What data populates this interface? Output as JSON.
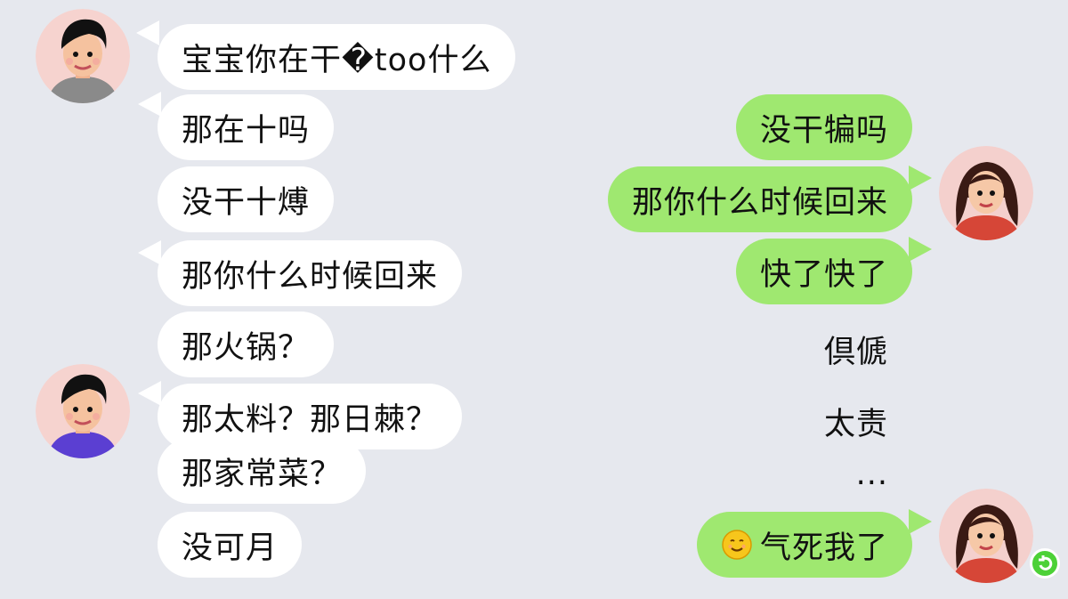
{
  "left_messages": [
    "宝宝你在干�too什么",
    "那在十吗",
    "没干十煿",
    "那你什么时候回来",
    "那火锅？",
    "那太料？那日棘？",
    "那家常菜？",
    "没可月"
  ],
  "right_messages": [
    "没干犏吗",
    "那你什么时候回来",
    "快了快了",
    "倶傂",
    "太责",
    "...",
    "气死我了"
  ],
  "colors": {
    "background": "#e6e8ee",
    "incoming_bubble": "#ffffff",
    "outgoing_bubble": "#9fe870"
  },
  "icons": {
    "left_avatar": "boy-avatar-icon",
    "right_avatar": "girl-avatar-icon",
    "emoji": "smiling-face-icon",
    "badge": "refresh-badge-icon"
  }
}
